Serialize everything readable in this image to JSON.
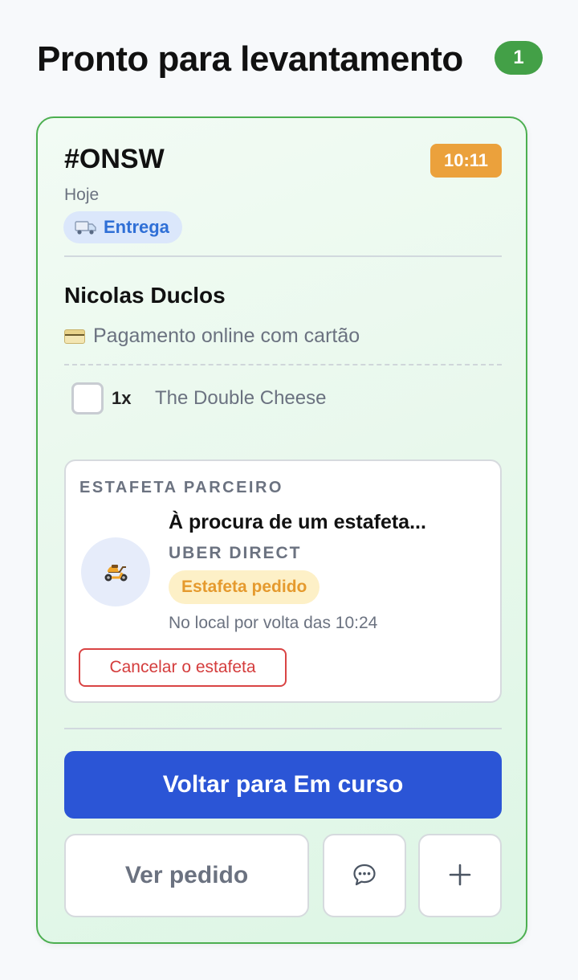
{
  "header": {
    "title": "Pronto para levantamento",
    "count": "1"
  },
  "order": {
    "id": "#ONSW",
    "time": "10:11",
    "day": "Hoje",
    "type_label": "Entrega",
    "customer_name": "Nicolas Duclos",
    "payment": "Pagamento online com cartão",
    "items": [
      {
        "qty": "1x",
        "name": "The Double Cheese"
      }
    ]
  },
  "courier": {
    "heading": "ESTAFETA PARCEIRO",
    "status": "À procura de um estafeta...",
    "provider": "UBER DIRECT",
    "state_label": "Estafeta pedido",
    "eta": "No local por volta das 10:24",
    "cancel_label": "Cancelar o estafeta"
  },
  "actions": {
    "primary_label": "Voltar para Em curso",
    "view_order_label": "Ver pedido",
    "chat_icon": "chat-bubble-icon",
    "add_icon": "plus-icon"
  },
  "colors": {
    "accent_green": "#4caf50",
    "primary_blue": "#2b55d6",
    "time_badge": "#eba13c",
    "danger": "#d94444"
  }
}
